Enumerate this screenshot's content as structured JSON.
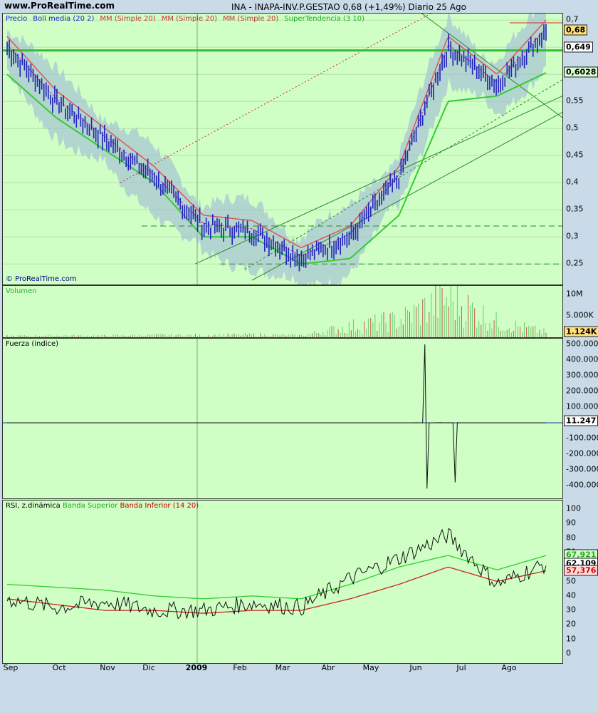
{
  "header": {
    "site": "www.ProRealTime.com",
    "title": "INA - INAPA-INV.P.GESTAO    0,68 (+1,49%)    Diario  25 Ago"
  },
  "price_panel": {
    "legend": [
      "Precio",
      "Boll media (20 2)",
      "MM (Simple 20)",
      "MM (Simple 20)",
      "MM (Simple 20)",
      "SuperTendencia (3 10)"
    ],
    "legend_colors": [
      "#1a1acc",
      "#1a1acc",
      "#cc3333",
      "#cc3333",
      "#cc3333",
      "#22aa22"
    ],
    "copyright": "© ProRealTime.com",
    "yticks": [
      "0,7",
      "0,65",
      "0,6",
      "0,55",
      "0,5",
      "0,45",
      "0,4",
      "0,35",
      "0,3",
      "0,25"
    ],
    "badges": [
      {
        "text": "0,68",
        "value": 0.68,
        "bg": "#ffe07a"
      },
      {
        "text": "0,649",
        "value": 0.649,
        "bg": "#ffffff"
      },
      {
        "text": "0,6028",
        "value": 0.6028,
        "bg": "#d8ffd0"
      }
    ]
  },
  "volume_panel": {
    "label": "Volumen",
    "yticks": [
      "10M",
      "5.000K"
    ],
    "badge": "1.124K"
  },
  "force_panel": {
    "label": "Fuerza (indice)",
    "yticks": [
      "500.000",
      "400.000",
      "300.000",
      "200.000",
      "100.000",
      "-100.000",
      "-200.000",
      "-300.000",
      "-400.000"
    ],
    "badge": "11.247"
  },
  "rsi_panel": {
    "label": "RSI, z.dinámica",
    "legend2": "Banda Superior",
    "legend3": "Banda Inferior (14 20)",
    "yticks": [
      "100",
      "90",
      "80",
      "70",
      "60",
      "50",
      "40",
      "30",
      "20",
      "10",
      "0"
    ],
    "badges": [
      {
        "text": "67,921",
        "value": 67.921,
        "bg": "#d8ffd0",
        "color": "#22aa22"
      },
      {
        "text": "62,109",
        "value": 62.109,
        "bg": "#ffffff",
        "color": "#000000"
      },
      {
        "text": "57,376",
        "value": 57.376,
        "bg": "#ffdede",
        "color": "#cc0000"
      }
    ]
  },
  "x_axis": [
    "Sep",
    "Oct",
    "Nov",
    "Dic",
    "2009",
    "Feb",
    "Mar",
    "Abr",
    "May",
    "Jun",
    "Jul",
    "Ago"
  ],
  "chart_data": {
    "type": "line",
    "title": "INA - INAPA-INV.P.GESTAO",
    "x": [
      "2008-09",
      "2008-10",
      "2008-11",
      "2008-12",
      "2009-01",
      "2009-02",
      "2009-03",
      "2009-04",
      "2009-05",
      "2009-06",
      "2009-07",
      "2009-08"
    ],
    "ylim": [
      0.22,
      0.72
    ],
    "series": [
      {
        "name": "Precio",
        "values": [
          0.65,
          0.55,
          0.48,
          0.41,
          0.32,
          0.31,
          0.26,
          0.3,
          0.41,
          0.65,
          0.58,
          0.68
        ]
      },
      {
        "name": "SuperTendencia (3 10)",
        "values": [
          0.6,
          0.52,
          0.46,
          0.4,
          0.3,
          0.3,
          0.25,
          0.26,
          0.34,
          0.55,
          0.56,
          0.6028
        ]
      },
      {
        "name": "RSI",
        "values": [
          38,
          32,
          36,
          30,
          30,
          35,
          32,
          52,
          66,
          82,
          48,
          62.109
        ]
      },
      {
        "name": "Banda Superior",
        "values": [
          48,
          46,
          44,
          40,
          38,
          40,
          38,
          48,
          60,
          68,
          58,
          67.921
        ]
      },
      {
        "name": "Banda Inferior (14 20)",
        "values": [
          38,
          34,
          30,
          30,
          28,
          30,
          30,
          38,
          48,
          60,
          50,
          57.376
        ]
      }
    ],
    "volume": [
      300,
      400,
      350,
      500,
      450,
      600,
      400,
      2500,
      4000,
      9000,
      3500,
      1124
    ],
    "force": [
      5,
      -20,
      10,
      -30,
      15,
      -10,
      20,
      80,
      300,
      500,
      -420,
      11.247
    ]
  }
}
